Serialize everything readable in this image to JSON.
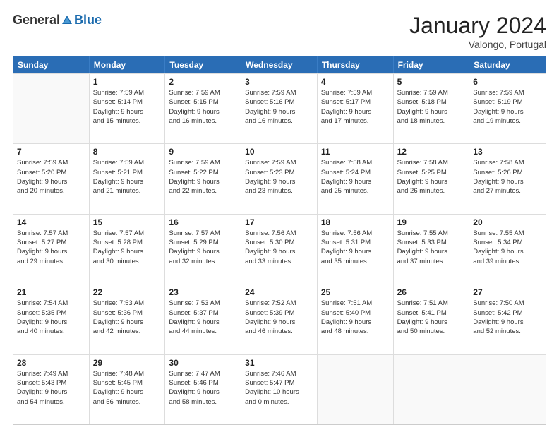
{
  "logo": {
    "general": "General",
    "blue": "Blue"
  },
  "title": "January 2024",
  "subtitle": "Valongo, Portugal",
  "days": [
    "Sunday",
    "Monday",
    "Tuesday",
    "Wednesday",
    "Thursday",
    "Friday",
    "Saturday"
  ],
  "weeks": [
    [
      {
        "day": "",
        "info": ""
      },
      {
        "day": "1",
        "info": "Sunrise: 7:59 AM\nSunset: 5:14 PM\nDaylight: 9 hours\nand 15 minutes."
      },
      {
        "day": "2",
        "info": "Sunrise: 7:59 AM\nSunset: 5:15 PM\nDaylight: 9 hours\nand 16 minutes."
      },
      {
        "day": "3",
        "info": "Sunrise: 7:59 AM\nSunset: 5:16 PM\nDaylight: 9 hours\nand 16 minutes."
      },
      {
        "day": "4",
        "info": "Sunrise: 7:59 AM\nSunset: 5:17 PM\nDaylight: 9 hours\nand 17 minutes."
      },
      {
        "day": "5",
        "info": "Sunrise: 7:59 AM\nSunset: 5:18 PM\nDaylight: 9 hours\nand 18 minutes."
      },
      {
        "day": "6",
        "info": "Sunrise: 7:59 AM\nSunset: 5:19 PM\nDaylight: 9 hours\nand 19 minutes."
      }
    ],
    [
      {
        "day": "7",
        "info": "Sunrise: 7:59 AM\nSunset: 5:20 PM\nDaylight: 9 hours\nand 20 minutes."
      },
      {
        "day": "8",
        "info": "Sunrise: 7:59 AM\nSunset: 5:21 PM\nDaylight: 9 hours\nand 21 minutes."
      },
      {
        "day": "9",
        "info": "Sunrise: 7:59 AM\nSunset: 5:22 PM\nDaylight: 9 hours\nand 22 minutes."
      },
      {
        "day": "10",
        "info": "Sunrise: 7:59 AM\nSunset: 5:23 PM\nDaylight: 9 hours\nand 23 minutes."
      },
      {
        "day": "11",
        "info": "Sunrise: 7:58 AM\nSunset: 5:24 PM\nDaylight: 9 hours\nand 25 minutes."
      },
      {
        "day": "12",
        "info": "Sunrise: 7:58 AM\nSunset: 5:25 PM\nDaylight: 9 hours\nand 26 minutes."
      },
      {
        "day": "13",
        "info": "Sunrise: 7:58 AM\nSunset: 5:26 PM\nDaylight: 9 hours\nand 27 minutes."
      }
    ],
    [
      {
        "day": "14",
        "info": "Sunrise: 7:57 AM\nSunset: 5:27 PM\nDaylight: 9 hours\nand 29 minutes."
      },
      {
        "day": "15",
        "info": "Sunrise: 7:57 AM\nSunset: 5:28 PM\nDaylight: 9 hours\nand 30 minutes."
      },
      {
        "day": "16",
        "info": "Sunrise: 7:57 AM\nSunset: 5:29 PM\nDaylight: 9 hours\nand 32 minutes."
      },
      {
        "day": "17",
        "info": "Sunrise: 7:56 AM\nSunset: 5:30 PM\nDaylight: 9 hours\nand 33 minutes."
      },
      {
        "day": "18",
        "info": "Sunrise: 7:56 AM\nSunset: 5:31 PM\nDaylight: 9 hours\nand 35 minutes."
      },
      {
        "day": "19",
        "info": "Sunrise: 7:55 AM\nSunset: 5:33 PM\nDaylight: 9 hours\nand 37 minutes."
      },
      {
        "day": "20",
        "info": "Sunrise: 7:55 AM\nSunset: 5:34 PM\nDaylight: 9 hours\nand 39 minutes."
      }
    ],
    [
      {
        "day": "21",
        "info": "Sunrise: 7:54 AM\nSunset: 5:35 PM\nDaylight: 9 hours\nand 40 minutes."
      },
      {
        "day": "22",
        "info": "Sunrise: 7:53 AM\nSunset: 5:36 PM\nDaylight: 9 hours\nand 42 minutes."
      },
      {
        "day": "23",
        "info": "Sunrise: 7:53 AM\nSunset: 5:37 PM\nDaylight: 9 hours\nand 44 minutes."
      },
      {
        "day": "24",
        "info": "Sunrise: 7:52 AM\nSunset: 5:39 PM\nDaylight: 9 hours\nand 46 minutes."
      },
      {
        "day": "25",
        "info": "Sunrise: 7:51 AM\nSunset: 5:40 PM\nDaylight: 9 hours\nand 48 minutes."
      },
      {
        "day": "26",
        "info": "Sunrise: 7:51 AM\nSunset: 5:41 PM\nDaylight: 9 hours\nand 50 minutes."
      },
      {
        "day": "27",
        "info": "Sunrise: 7:50 AM\nSunset: 5:42 PM\nDaylight: 9 hours\nand 52 minutes."
      }
    ],
    [
      {
        "day": "28",
        "info": "Sunrise: 7:49 AM\nSunset: 5:43 PM\nDaylight: 9 hours\nand 54 minutes."
      },
      {
        "day": "29",
        "info": "Sunrise: 7:48 AM\nSunset: 5:45 PM\nDaylight: 9 hours\nand 56 minutes."
      },
      {
        "day": "30",
        "info": "Sunrise: 7:47 AM\nSunset: 5:46 PM\nDaylight: 9 hours\nand 58 minutes."
      },
      {
        "day": "31",
        "info": "Sunrise: 7:46 AM\nSunset: 5:47 PM\nDaylight: 10 hours\nand 0 minutes."
      },
      {
        "day": "",
        "info": ""
      },
      {
        "day": "",
        "info": ""
      },
      {
        "day": "",
        "info": ""
      }
    ]
  ]
}
